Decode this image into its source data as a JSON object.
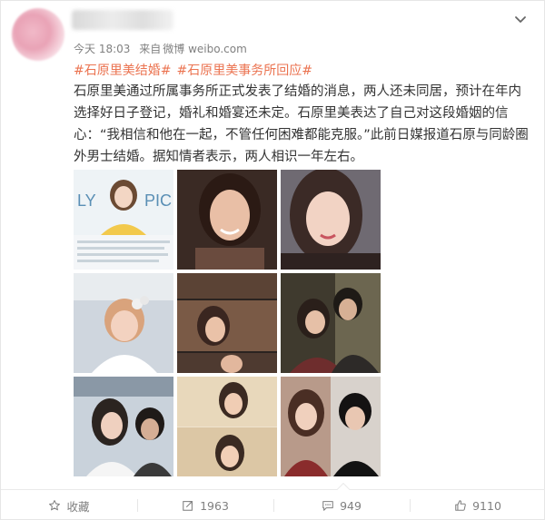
{
  "post": {
    "time": "今天 18:03",
    "source_prefix": "来自",
    "source": "微博 weibo.com",
    "tags": [
      "#石原里美结婚#",
      "#石原里美事务所回应#"
    ],
    "text": "石原里美通过所属事务所正式发表了结婚的消息，两人还未同居，预计在年内选择好日子登记，婚礼和婚宴还未定。石原里美表达了自己对这段婚姻的信心：“我相信和他在一起，不管任何困难都能克服。”此前日媒报道石原与同龄圈外男士结婚。据知情者表示，两人相识一年左右。",
    "image_count": 9
  },
  "actions": {
    "favorite_label": "收藏",
    "repost_count": "1963",
    "comment_count": "949",
    "like_count": "9110"
  },
  "icons": {
    "chevron": "chevron-down-icon",
    "favorite": "star-icon",
    "repost": "repost-icon",
    "comment": "comment-icon",
    "like": "thumbs-up-icon"
  },
  "colors": {
    "tag": "#eb7350",
    "text": "#333333",
    "meta": "#808080"
  }
}
